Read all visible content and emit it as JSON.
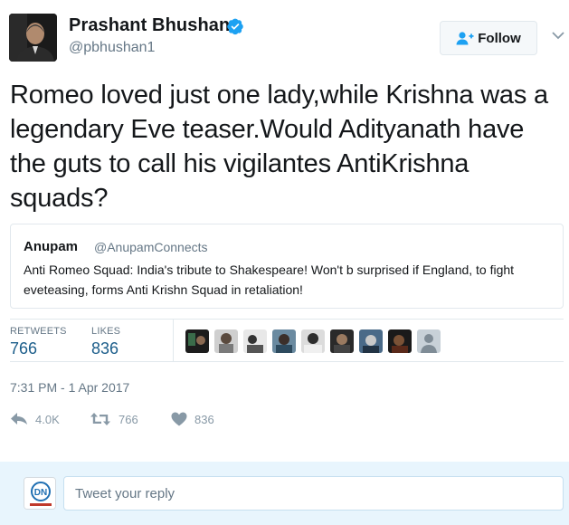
{
  "author": {
    "name": "Prashant Bhushan",
    "handle": "@pbhushan1",
    "verified": true
  },
  "follow_button": {
    "label": "Follow",
    "icon": "follow-person-plus-icon"
  },
  "tweet": {
    "text": "Romeo loved just one lady,while Krishna was a legendary Eve teaser.Would Adityanath have the guts to call his vigilantes AntiKrishna squads?"
  },
  "quoted_tweet": {
    "name": "Anupam",
    "handle": "@AnupamConnects",
    "text": "Anti Romeo Squad: India's tribute to Shakespeare! Won't b surprised if England, to fight eveteasing, forms Anti Krishn Squad in retaliation!"
  },
  "stats": {
    "retweets_label": "RETWEETS",
    "retweets": "766",
    "likes_label": "LIKES",
    "likes": "836",
    "likers_shown": 9
  },
  "timestamp": "7:31 PM - 1 Apr 2017",
  "actions": {
    "reply_count": "4.0K",
    "retweet_count": "766",
    "like_count": "836"
  },
  "reply_box": {
    "placeholder": "Tweet your reply",
    "avatar_text": "DN"
  },
  "colors": {
    "link_blue": "#1b5d8a",
    "verified_blue": "#1da1f2",
    "muted": "#657786",
    "reply_bg": "#e8f5fd"
  }
}
